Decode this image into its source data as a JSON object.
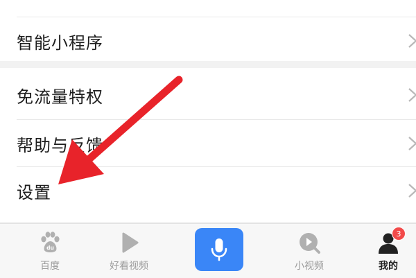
{
  "menu": {
    "top_item": {
      "label": "智能小程序"
    },
    "items": [
      {
        "label": "免流量特权"
      },
      {
        "label": "帮助与反馈"
      },
      {
        "label": "设置"
      }
    ]
  },
  "tabbar": {
    "tabs": [
      {
        "label": "百度",
        "icon": "baidu-paw-icon"
      },
      {
        "label": "好看视频",
        "icon": "play-icon"
      },
      {
        "label": "",
        "icon": "microphone-icon"
      },
      {
        "label": "小视频",
        "icon": "mini-video-icon"
      },
      {
        "label": "我的",
        "icon": "user-icon",
        "badge": "3"
      }
    ]
  },
  "colors": {
    "accent": "#3a86f7",
    "arrow": "#e8232a",
    "badge": "#f24a4a",
    "inactive_tab": "#9a9a9a"
  }
}
